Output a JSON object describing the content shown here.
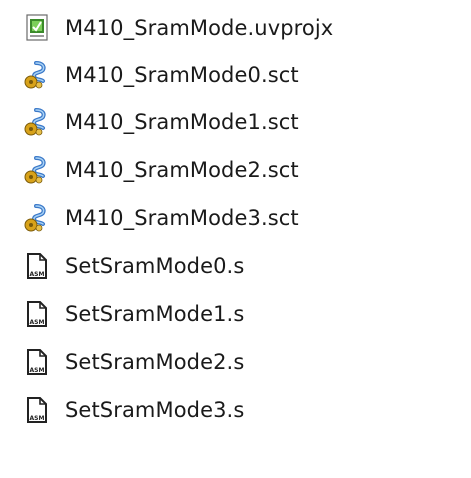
{
  "files": [
    {
      "name": "M410_SramMode.uvprojx",
      "icon": "uvision-project-icon"
    },
    {
      "name": "M410_SramMode0.sct",
      "icon": "scatter-file-icon"
    },
    {
      "name": "M410_SramMode1.sct",
      "icon": "scatter-file-icon"
    },
    {
      "name": "M410_SramMode2.sct",
      "icon": "scatter-file-icon"
    },
    {
      "name": "M410_SramMode3.sct",
      "icon": "scatter-file-icon"
    },
    {
      "name": "SetSramMode0.s",
      "icon": "asm-file-icon"
    },
    {
      "name": "SetSramMode1.s",
      "icon": "asm-file-icon"
    },
    {
      "name": "SetSramMode2.s",
      "icon": "asm-file-icon"
    },
    {
      "name": "SetSramMode3.s",
      "icon": "asm-file-icon"
    }
  ],
  "icon_text": {
    "asm": "ASM"
  },
  "colors": {
    "project_green": "#3a8a2a",
    "scatter_blue": "#3a78c8",
    "scatter_gold": "#d8a21a"
  }
}
